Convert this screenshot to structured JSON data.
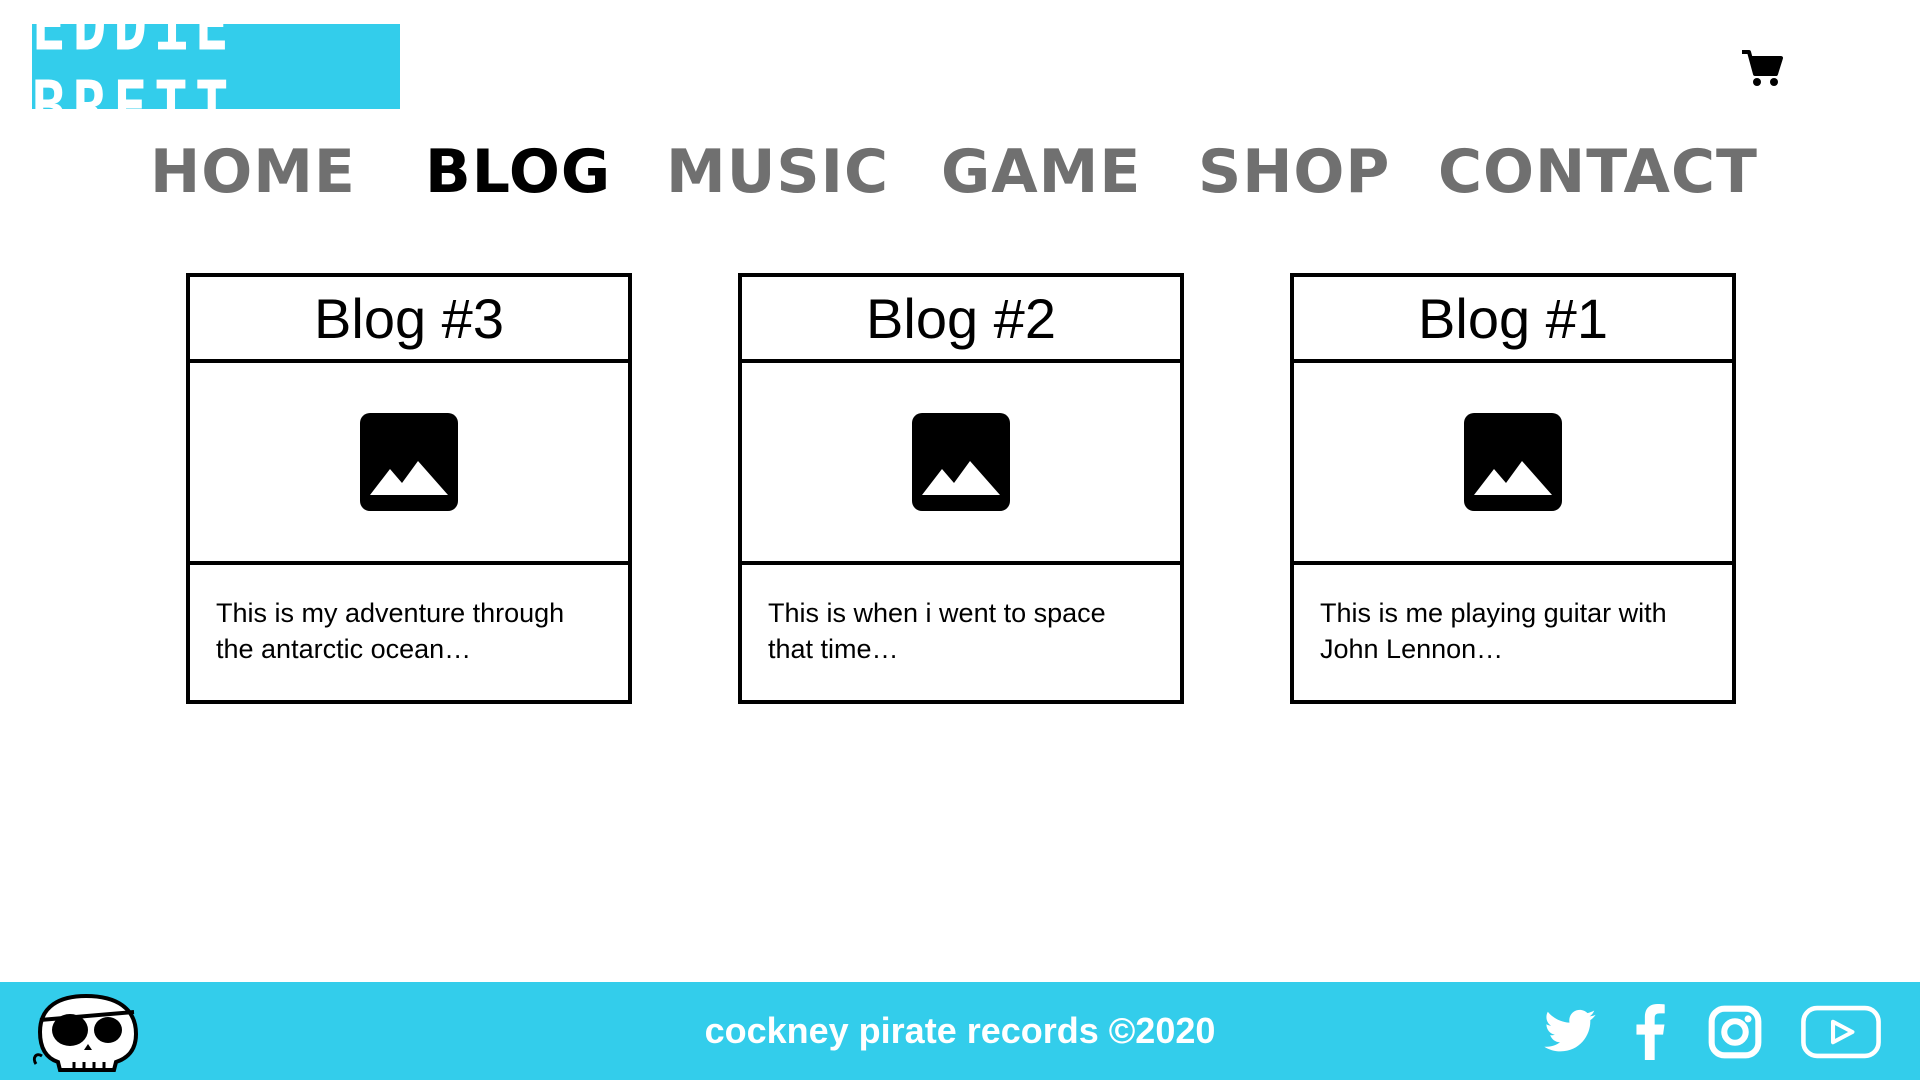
{
  "header": {
    "logo_text": "EDDiE BRETT",
    "cart_icon": "cart-icon"
  },
  "nav": {
    "items": [
      {
        "label": "HOME",
        "active": false
      },
      {
        "label": "BLOG",
        "active": true
      },
      {
        "label": "MUSIC",
        "active": false
      },
      {
        "label": "GAME",
        "active": false
      },
      {
        "label": "SHOP",
        "active": false
      },
      {
        "label": "CONTACT",
        "active": false
      }
    ]
  },
  "posts": [
    {
      "title": "Blog #3",
      "image_icon": "image-placeholder-icon",
      "excerpt": "This is my adventure through the antarctic ocean…"
    },
    {
      "title": "Blog #2",
      "image_icon": "image-placeholder-icon",
      "excerpt": "This is when i went to space that time…"
    },
    {
      "title": "Blog #1",
      "image_icon": "image-placeholder-icon",
      "excerpt": "This is me playing guitar with John Lennon…"
    }
  ],
  "footer": {
    "text": "cockney pirate records ©2020",
    "mascot_icon": "pirate-skull-icon",
    "social_icons": [
      "twitter-icon",
      "facebook-icon",
      "instagram-icon",
      "youtube-icon"
    ]
  },
  "colors": {
    "accent": "#33cdeb",
    "nav_inactive": "#707070",
    "nav_active": "#000000"
  }
}
